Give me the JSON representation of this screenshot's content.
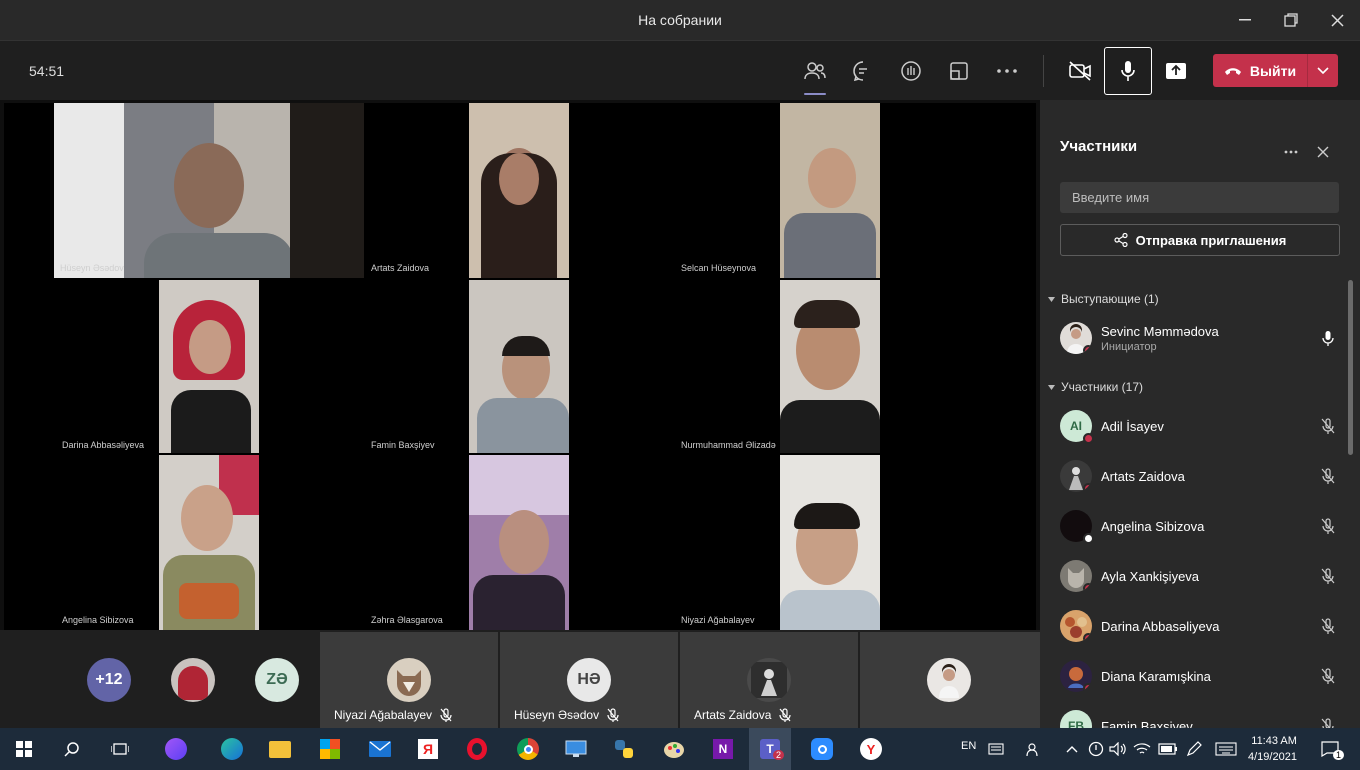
{
  "window": {
    "title": "На собрании"
  },
  "toolbar": {
    "timer": "54:51",
    "leave_label": "Выйти"
  },
  "colors": {
    "leave": "#c4314b",
    "accent": "#8b8cc7",
    "panel": "#292929"
  },
  "stage": {
    "tiles": [
      {
        "name": "Hüseyn Əsədov"
      },
      {
        "name": "Artats Zaidova"
      },
      {
        "name": "Selcan Hüseynova"
      },
      {
        "name": "Darina Abbasəliyeva"
      },
      {
        "name": "Famin Baxşiyev"
      },
      {
        "name": "Nurmuhammad Əlizadə"
      },
      {
        "name": "Angelina Sibizova"
      },
      {
        "name": "Zəhra Əlasgarova"
      },
      {
        "name": "Niyazi Ağabalayev"
      }
    ]
  },
  "strip": {
    "overflow": "+12",
    "ze_initials": "ZƏ",
    "tiles": [
      {
        "name": "Niyazi Ağabalayev",
        "initials": ""
      },
      {
        "name": "Hüseyn Əsədov",
        "initials": "HƏ"
      },
      {
        "name": "Artats Zaidova",
        "initials": ""
      },
      {
        "name": "",
        "initials": ""
      }
    ]
  },
  "panel": {
    "title": "Участники",
    "search_placeholder": "Введите имя",
    "invite_label": "Отправка приглашения",
    "presenters_header": "Выступающие (1)",
    "attendees_header": "Участники (17)",
    "presenter": {
      "name": "Sevinc Məmmədova",
      "role": "Инициатор"
    },
    "attendees": [
      {
        "name": "Adil İsayev",
        "initials": "AI"
      },
      {
        "name": "Artats Zaidova",
        "initials": ""
      },
      {
        "name": "Angelina Sibizova",
        "initials": ""
      },
      {
        "name": "Ayla Xankişiyeva",
        "initials": ""
      },
      {
        "name": "Darina Abbasəliyeva",
        "initials": ""
      },
      {
        "name": "Diana Karamışkina",
        "initials": ""
      },
      {
        "name": "Famin Baxşiyev",
        "initials": "FB"
      }
    ]
  },
  "taskbar": {
    "lang": "EN",
    "time": "11:43 AM",
    "date": "4/19/2021",
    "teams_badge": "2",
    "notif_badge": "1"
  }
}
